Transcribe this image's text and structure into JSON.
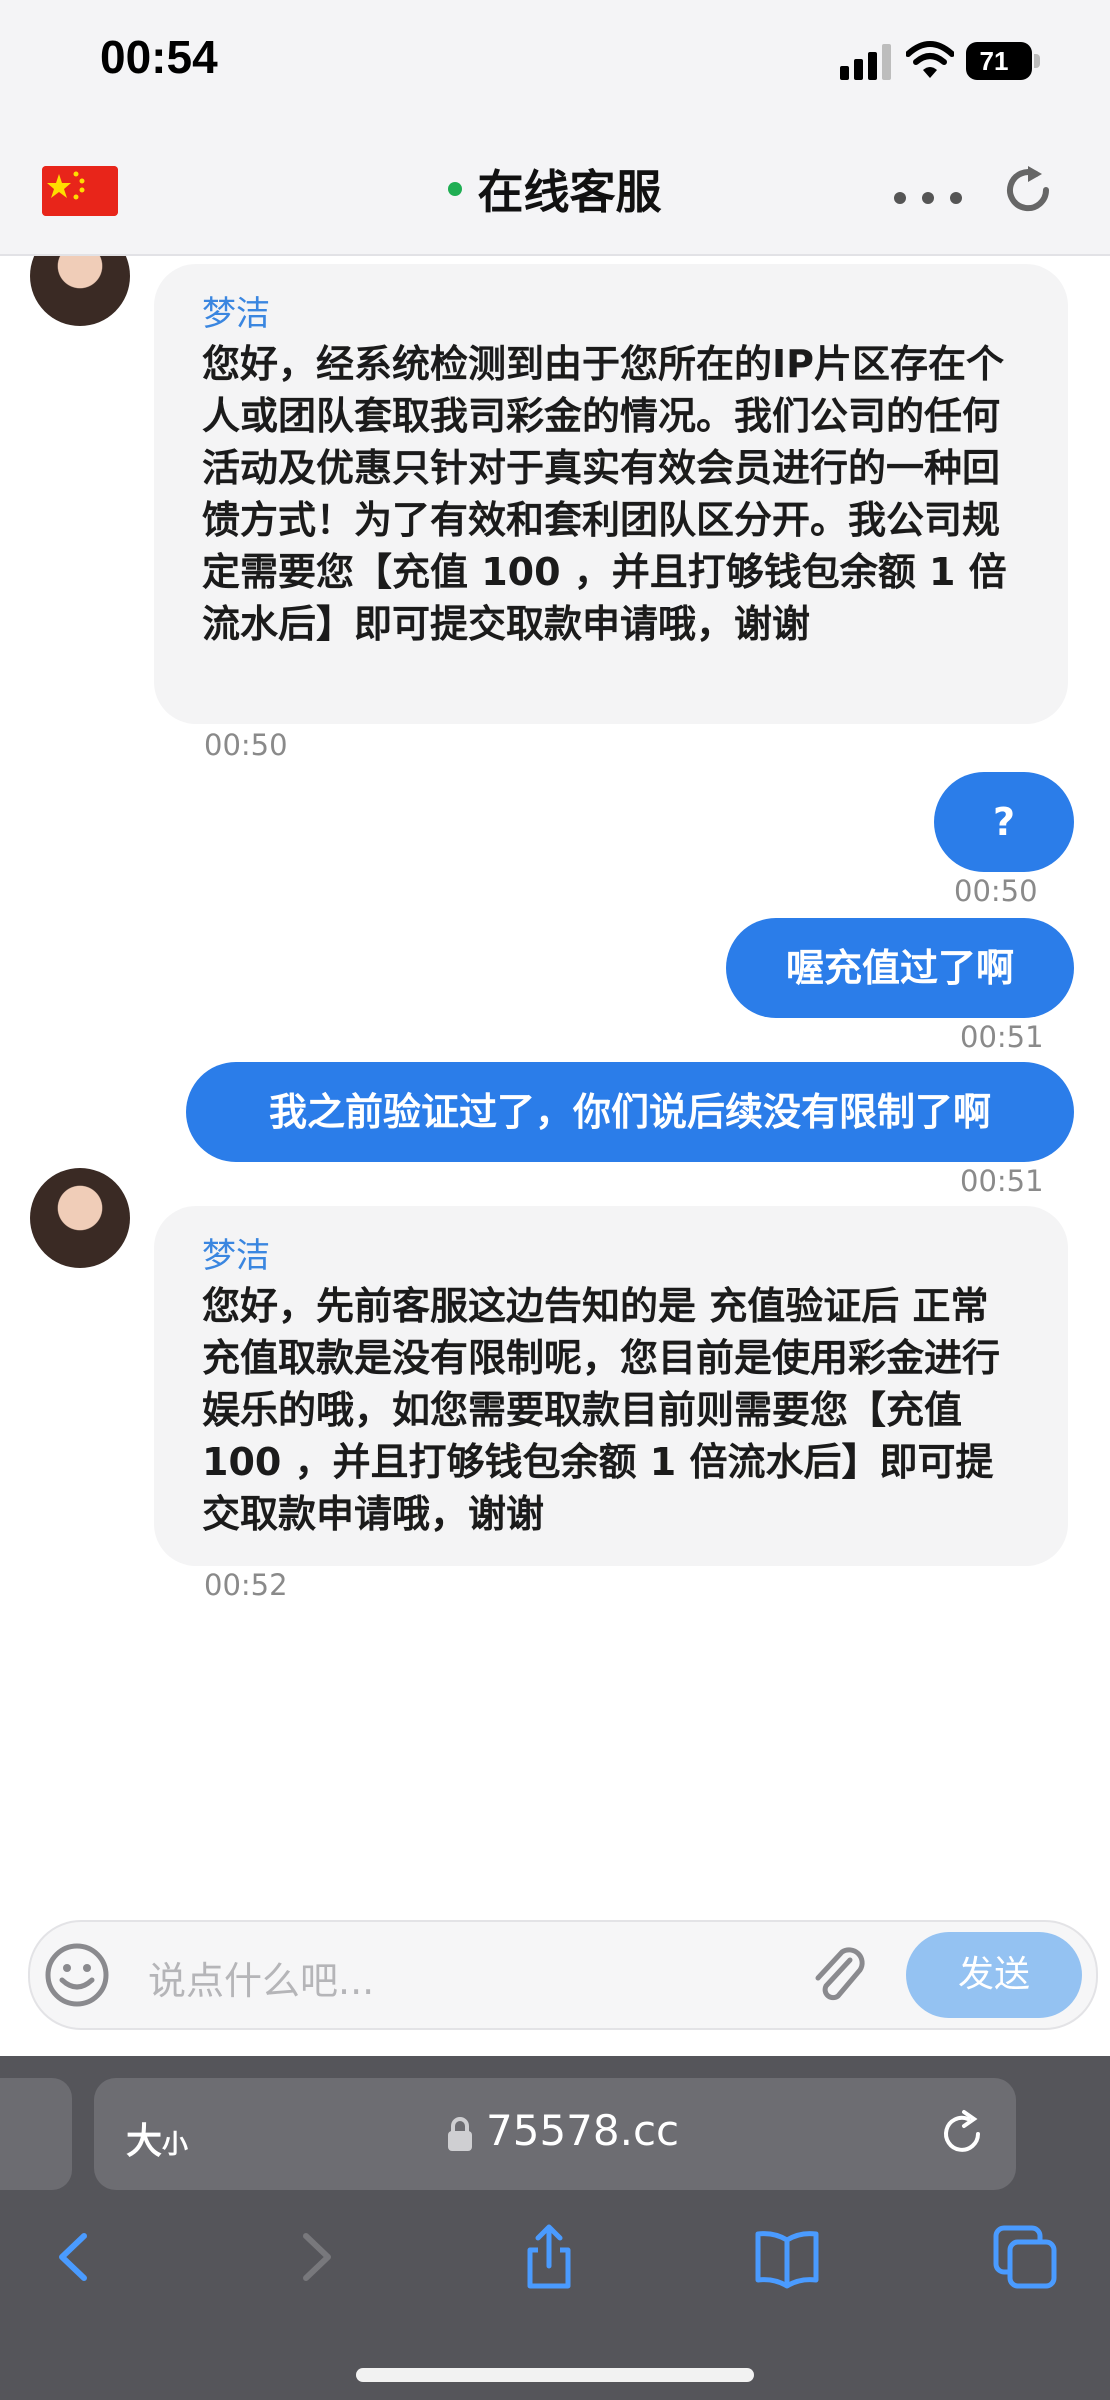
{
  "status_bar": {
    "time": "00:54",
    "battery": "71"
  },
  "header": {
    "title": "在线客服"
  },
  "messages": [
    {
      "direction": "in",
      "sender": "梦洁",
      "text": "您好，经系统检测到由于您所在的IP片区存在个人或团队套取我司彩金的情况。我们公司的任何活动及优惠只针对于真实有效会员进行的一种回馈方式！为了有效和套利团队区分开。我公司规定需要您【充值 100 ，并且打够钱包余额 1 倍流水后】即可提交取款申请哦，谢谢",
      "time": "00:50"
    },
    {
      "direction": "out",
      "text": "?",
      "time": "00:50"
    },
    {
      "direction": "out",
      "text": "喔充值过了啊",
      "time": "00:51"
    },
    {
      "direction": "out",
      "text": "我之前验证过了，你们说后续没有限制了啊",
      "time": "00:51"
    },
    {
      "direction": "in",
      "sender": "梦洁",
      "text": "您好，先前客服这边告知的是 充值验证后 正常充值取款是没有限制呢，您目前是使用彩金进行娱乐的哦，如您需要取款目前则需要您【充值 100 ，并且打够钱包余额 1 倍流水后】即可提交取款申请哦，谢谢",
      "time": "00:52"
    }
  ],
  "input": {
    "placeholder": "说点什么吧...",
    "send_label": "发送"
  },
  "browser": {
    "text_size_label": "大",
    "text_size_small": "小",
    "url": "75578.cc"
  },
  "colors": {
    "accent": "#2b7de9",
    "send_disabled": "#94c2f2",
    "online": "#1fae53"
  },
  "icons": [
    "chinese-flag-icon",
    "more-dots-icon",
    "refresh-icon",
    "emoji-icon",
    "paperclip-icon",
    "lock-icon",
    "reload-icon",
    "back-icon",
    "forward-icon",
    "share-icon",
    "bookmarks-icon",
    "tabs-icon"
  ]
}
